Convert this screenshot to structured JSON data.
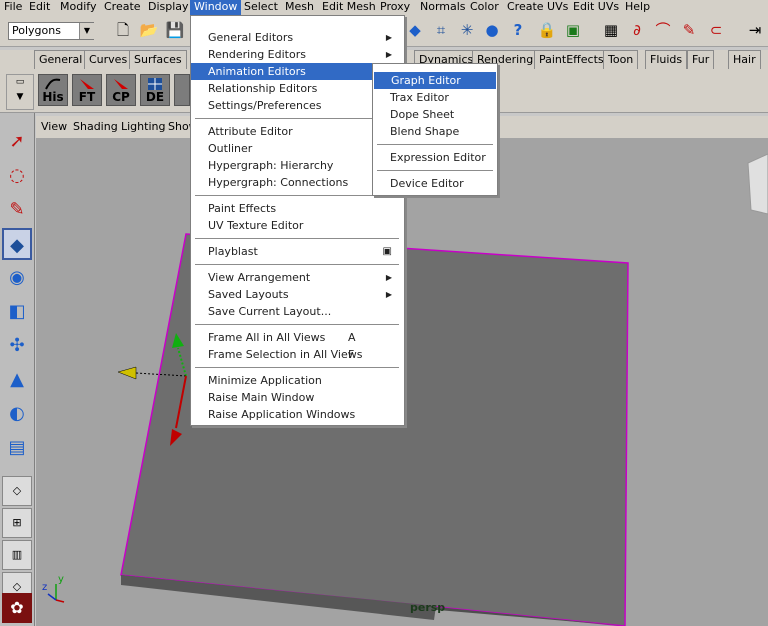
{
  "menubar": {
    "items": [
      "File",
      "Edit",
      "Modify",
      "Create",
      "Display",
      "Window",
      "Select",
      "Mesh",
      "Edit Mesh",
      "Proxy",
      "Normals",
      "Color",
      "Create UVs",
      "Edit UVs",
      "Help"
    ],
    "active": "Window"
  },
  "toolbar": {
    "mode_select": "Polygons",
    "icons": [
      "new-scene-icon",
      "open-scene-icon",
      "save-scene-icon",
      "poly-sphere-icon",
      "component-icon",
      "camera-icon",
      "help-icon",
      "lock-icon",
      "snap-grid-icon",
      "snap-curve-icon",
      "snap-point-icon",
      "snap-view-icon",
      "magnet-icon",
      "history-icon"
    ]
  },
  "shelf": {
    "tabs": [
      "General",
      "Curves",
      "Surfaces",
      "Dynamics",
      "Rendering",
      "PaintEffects",
      "Toon",
      "Fluids",
      "Fur",
      "Hair"
    ],
    "buttons": [
      "His",
      "FT",
      "CP",
      "DE"
    ]
  },
  "viewport": {
    "menu": [
      "View",
      "Shading",
      "Lighting",
      "Show"
    ],
    "camera_label": "persp",
    "axis_x": "z",
    "axis_y": "y"
  },
  "window_menu": {
    "items": [
      {
        "label": "General Editors",
        "submenu": true
      },
      {
        "label": "Rendering Editors",
        "submenu": true
      },
      {
        "label": "Animation Editors",
        "submenu": true,
        "highlighted": true
      },
      {
        "label": "Relationship Editors",
        "submenu": true
      },
      {
        "label": "Settings/Preferences",
        "submenu": true
      },
      {
        "label": "Attribute Editor"
      },
      {
        "label": "Outliner"
      },
      {
        "label": "Hypergraph: Hierarchy"
      },
      {
        "label": "Hypergraph: Connections"
      },
      {
        "label": "Paint Effects"
      },
      {
        "label": "UV Texture Editor"
      },
      {
        "label": "Playblast",
        "option_box": true
      },
      {
        "label": "View Arrangement",
        "submenu": true
      },
      {
        "label": "Saved Layouts",
        "submenu": true
      },
      {
        "label": "Save Current Layout..."
      },
      {
        "label": "Frame All in All Views",
        "shortcut": "A"
      },
      {
        "label": "Frame Selection in All Views",
        "shortcut": "F"
      },
      {
        "label": "Minimize Application"
      },
      {
        "label": "Raise Main Window"
      },
      {
        "label": "Raise Application Windows"
      }
    ]
  },
  "animation_submenu": {
    "items": [
      {
        "label": "Graph Editor",
        "highlighted": true
      },
      {
        "label": "Trax Editor"
      },
      {
        "label": "Dope Sheet"
      },
      {
        "label": "Blend Shape"
      },
      {
        "label": "Expression Editor"
      },
      {
        "label": "Device Editor"
      }
    ]
  },
  "colors": {
    "highlight": "#316ac5",
    "plane_edge": "#c800c8",
    "plane_fill": "#6e6e6e",
    "viewport_bg": "#a3a3a3"
  }
}
